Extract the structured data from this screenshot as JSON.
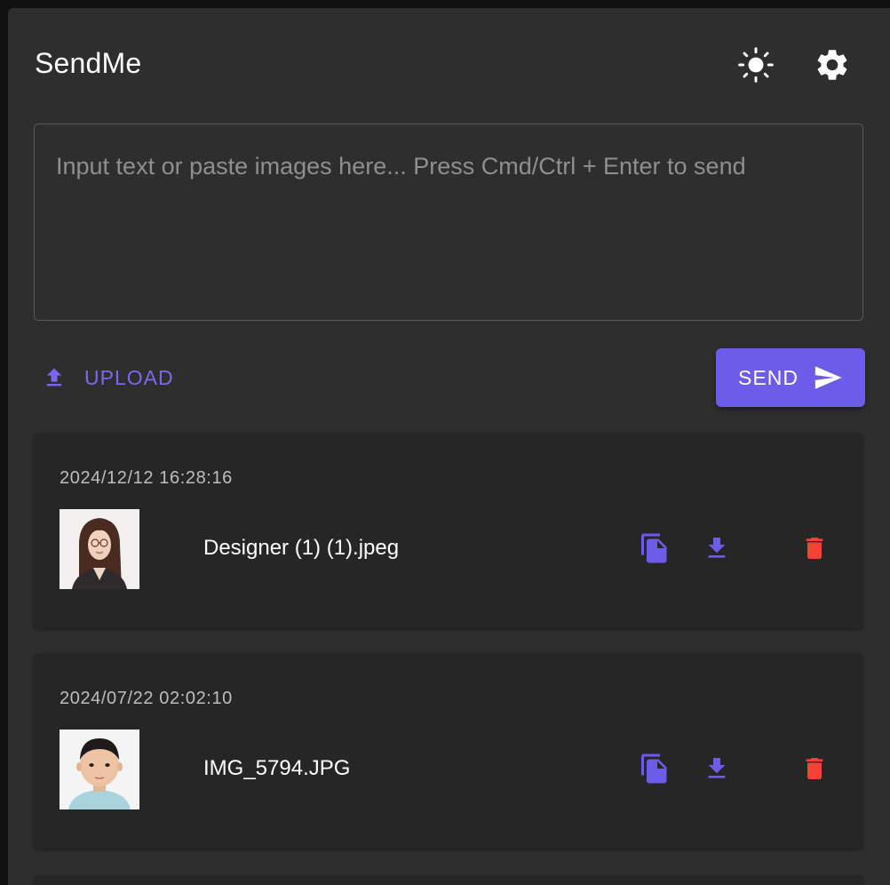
{
  "app": {
    "title": "SendMe"
  },
  "header": {
    "theme_icon": "brightness-icon",
    "settings_icon": "gear-icon"
  },
  "composer": {
    "placeholder": "Input text or paste images here... Press Cmd/Ctrl + Enter to send",
    "value": ""
  },
  "actions": {
    "upload_label": "UPLOAD",
    "send_label": "SEND"
  },
  "colors": {
    "accent": "#6c5ce7",
    "accent_text": "#7b68ee",
    "danger": "#f44336",
    "background": "#2e2e2e",
    "card": "#262626"
  },
  "messages": [
    {
      "timestamp": "2024/12/12 16:28:16",
      "filename": "Designer (1) (1).jpeg",
      "thumbnail": "woman-portrait-image"
    },
    {
      "timestamp": "2024/07/22 02:02:10",
      "filename": "IMG_5794.JPG",
      "thumbnail": "child-portrait-image"
    }
  ]
}
